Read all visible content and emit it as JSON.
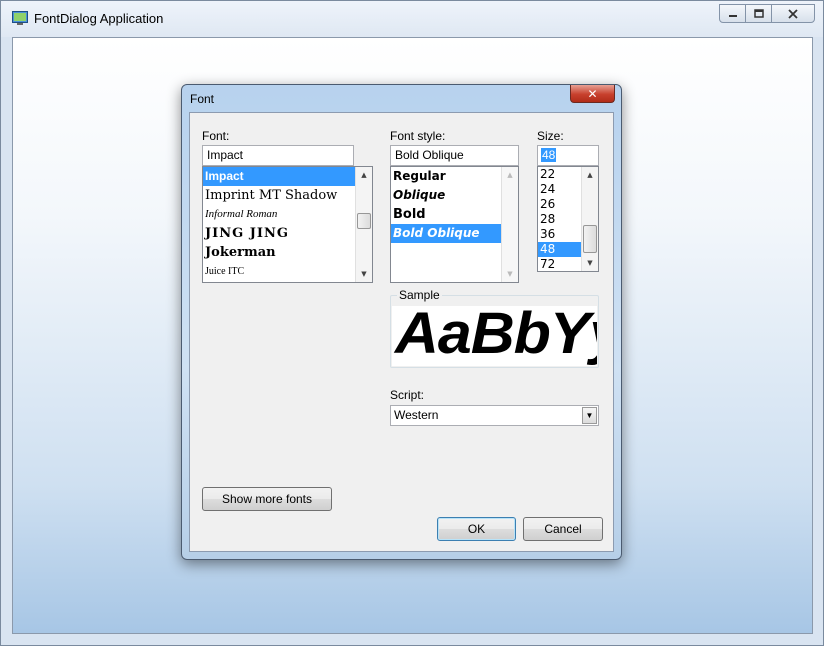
{
  "app": {
    "title": "FontDialog Application",
    "icon": "app-window-icon",
    "caption_buttons": [
      "minimize-icon",
      "maximize-icon",
      "close-icon"
    ]
  },
  "dialog": {
    "title": "Font",
    "close_glyph": "✕",
    "font": {
      "label": "Font:",
      "value": "Impact",
      "items": [
        "Impact",
        "Imprint MT Shadow",
        "Informal Roman",
        "JING JING",
        "Jokerman",
        "Juice ITC"
      ],
      "selected": "Impact"
    },
    "font_style": {
      "label": "Font style:",
      "value": "Bold Oblique",
      "items": [
        "Regular",
        "Oblique",
        "Bold",
        "Bold Oblique"
      ],
      "selected": "Bold Oblique"
    },
    "size": {
      "label": "Size:",
      "value": "48",
      "items": [
        "22",
        "24",
        "26",
        "28",
        "36",
        "48",
        "72"
      ],
      "selected": "48"
    },
    "sample": {
      "label": "Sample",
      "text": "AaBbYyZz"
    },
    "script": {
      "label": "Script:",
      "value": "Western"
    },
    "buttons": {
      "show_more": "Show more fonts",
      "ok": "OK",
      "cancel": "Cancel"
    }
  },
  "colors": {
    "selection": "#3399ff",
    "close_button": "#c7402d"
  }
}
